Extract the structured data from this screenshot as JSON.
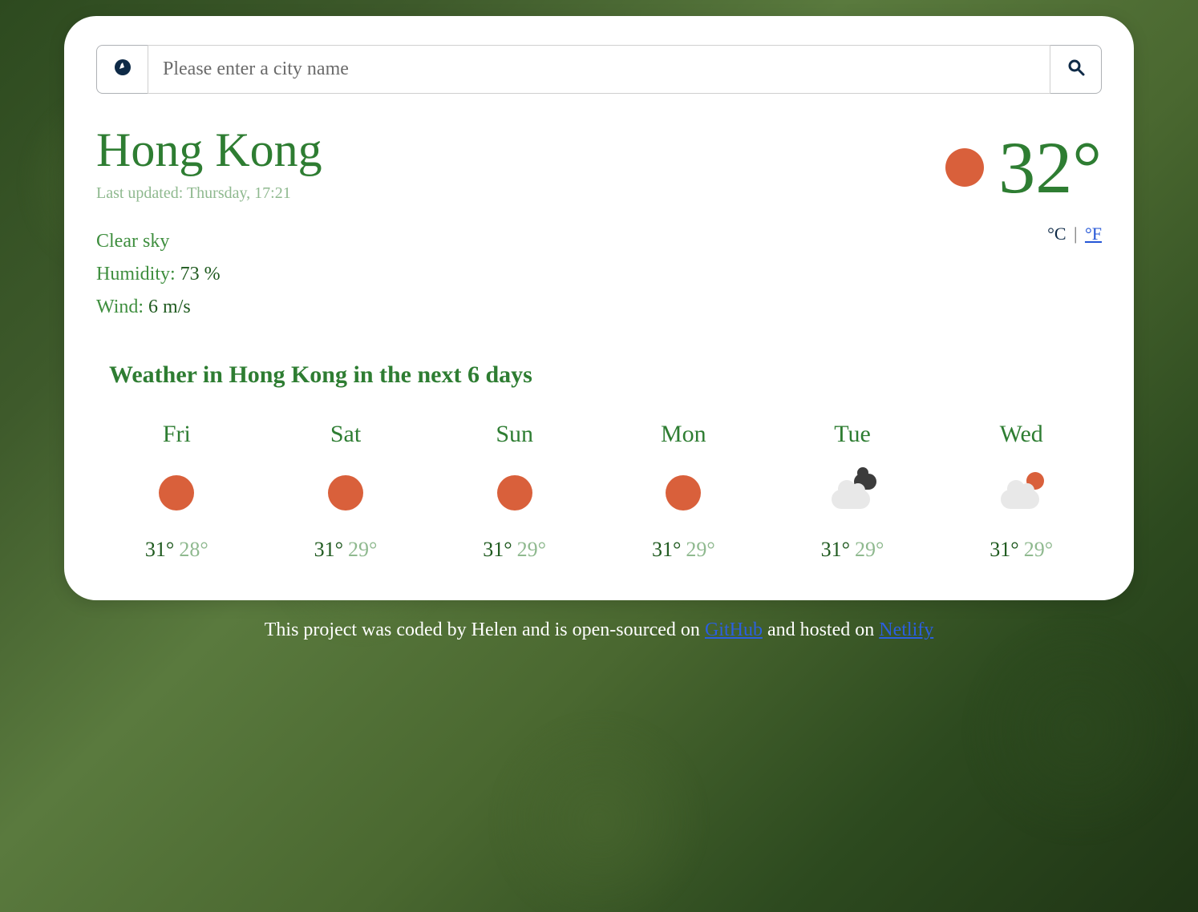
{
  "search": {
    "placeholder": "Please enter a city name"
  },
  "city": "Hong Kong",
  "updated": "Last updated: Thursday, 17:21",
  "conditions": {
    "sky": "Clear sky",
    "humidity_label": "Humidity: ",
    "humidity_value": "73 %",
    "wind_label": "Wind: ",
    "wind_value": "6 m/s"
  },
  "current": {
    "temp": "32°",
    "icon": "sun",
    "unit_c": "°C",
    "unit_sep": " | ",
    "unit_f": "°F"
  },
  "forecast": {
    "title": "Weather in Hong Kong in the next 6 days",
    "days": [
      {
        "name": "Fri",
        "icon": "sun",
        "hi": "31°",
        "lo": "28°"
      },
      {
        "name": "Sat",
        "icon": "sun",
        "hi": "31°",
        "lo": "29°"
      },
      {
        "name": "Sun",
        "icon": "sun",
        "hi": "31°",
        "lo": "29°"
      },
      {
        "name": "Mon",
        "icon": "sun",
        "hi": "31°",
        "lo": "29°"
      },
      {
        "name": "Tue",
        "icon": "cloud-dark",
        "hi": "31°",
        "lo": "29°"
      },
      {
        "name": "Wed",
        "icon": "cloud-sun",
        "hi": "31°",
        "lo": "29°"
      }
    ]
  },
  "footer": {
    "t1": "This project was coded by Helen and is open-sourced on ",
    "link1": "GitHub",
    "t2": " and hosted on ",
    "link2": "Netlify"
  }
}
